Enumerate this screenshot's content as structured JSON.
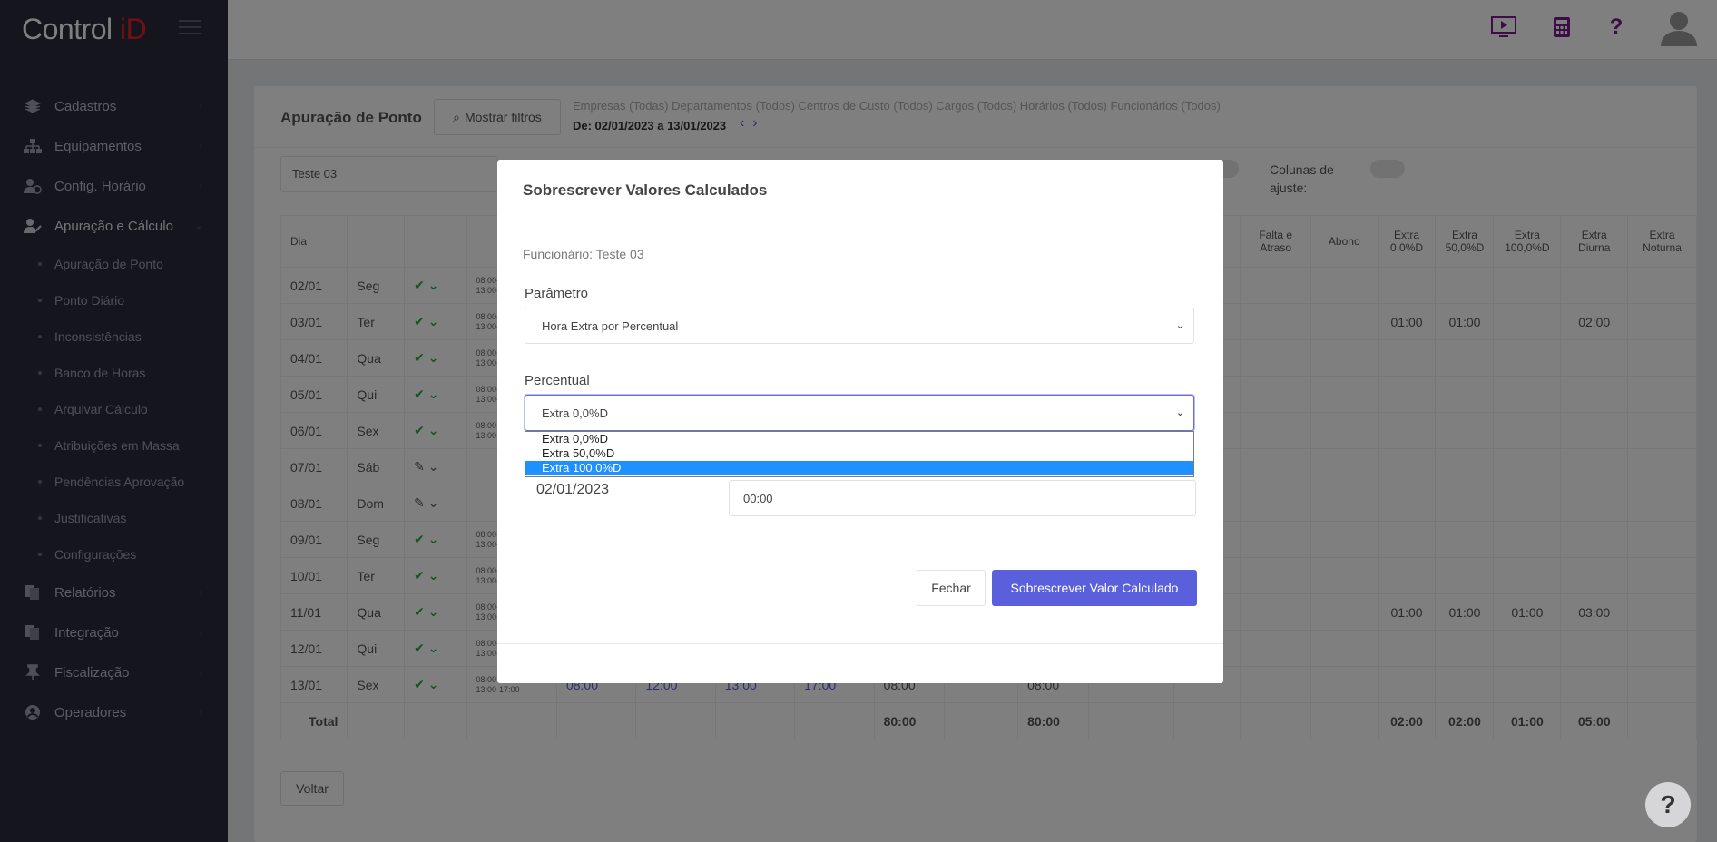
{
  "app": {
    "logo_main": "Control ",
    "logo_id": "iD"
  },
  "sidebar": {
    "items": [
      {
        "label": "Cadastros",
        "icon": "layers-icon"
      },
      {
        "label": "Equipamentos",
        "icon": "sitemap-icon"
      },
      {
        "label": "Config. Horário",
        "icon": "user-clock-icon"
      },
      {
        "label": "Apuração e Cálculo",
        "icon": "user-edit-icon"
      }
    ],
    "subitems": [
      "Apuração de Ponto",
      "Ponto Diário",
      "Inconsistências",
      "Banco de Horas",
      "Arquivar Cálculo",
      "Atribuições em Massa",
      "Pendências Aprovação",
      "Justificativas",
      "Configurações"
    ],
    "items_after": [
      {
        "label": "Relatórios",
        "icon": "files-icon"
      },
      {
        "label": "Integração",
        "icon": "files-icon"
      },
      {
        "label": "Fiscalização",
        "icon": "pin-icon"
      },
      {
        "label": "Operadores",
        "icon": "user-circle-icon"
      }
    ]
  },
  "header": {
    "icons": [
      "monitor-play-icon",
      "calculator-icon",
      "question-icon",
      "user-avatar-icon"
    ]
  },
  "page": {
    "title": "Apuração de Ponto",
    "filter_button": "Mostrar filtros",
    "filters": "Empresas (Todas)  Departamentos (Todos)  Centros de Custo (Todos)  Cargos (Todos)  Horários (Todos)  Funcionários (Todos)",
    "date_range": "De: 02/01/2023 a 13/01/2023",
    "employee": "Teste 03",
    "columns_adjust": "Colunas de ajuste:",
    "col_dia": "Dia",
    "extra_headers": [
      "Falta e Atraso",
      "Abono",
      "Extra 0,0%D",
      "Extra 50,0%D",
      "Extra 100,0%D",
      "Extra Diurna",
      "Extra Noturna"
    ],
    "rows": [
      {
        "d": "02/01",
        "w": "Seg",
        "ok": true,
        "sch": "08:00-12:...\n13:00-17:..."
      },
      {
        "d": "03/01",
        "w": "Ter",
        "ok": true,
        "sch": "08:00-12:...\n13:00-17:..."
      },
      {
        "d": "04/01",
        "w": "Qua",
        "ok": true,
        "sch": "08:00-12:...\n13:00-17:..."
      },
      {
        "d": "05/01",
        "w": "Qui",
        "ok": true,
        "sch": "08:00-12:...\n13:00-17:..."
      },
      {
        "d": "06/01",
        "w": "Sex",
        "ok": true,
        "sch": "08:00-12:...\n13:00-17:..."
      },
      {
        "d": "07/01",
        "w": "Sáb",
        "ok": false,
        "sch": ""
      },
      {
        "d": "08/01",
        "w": "Dom",
        "ok": false,
        "sch": ""
      },
      {
        "d": "09/01",
        "w": "Seg",
        "ok": true,
        "sch": "08:00-12:...\n13:00-17:..."
      },
      {
        "d": "10/01",
        "w": "Ter",
        "ok": true,
        "sch": "08:00-12:...\n13:00-17:..."
      },
      {
        "d": "11/01",
        "w": "Qua",
        "ok": true,
        "sch": "08:00-12:...\n13:00-17:..."
      },
      {
        "d": "12/01",
        "w": "Qui",
        "ok": true,
        "sch": "08:00-12:...\n13:00-17:..."
      },
      {
        "d": "13/01",
        "w": "Sex",
        "ok": true,
        "sch": "08:00-12:00\n13:00-17:00"
      }
    ],
    "row13_punches": [
      "08:00",
      "12:00",
      "13:00",
      "17:00",
      "08:00",
      "08:00"
    ],
    "row03_extras": {
      "e0": "01:00",
      "e50": "01:00",
      "diurna": "02:00"
    },
    "row11_extras": {
      "e0": "01:00",
      "e50": "01:00",
      "e100": "01:00",
      "diurna": "03:00"
    },
    "total_label": "Total",
    "totals": {
      "t1": "80:00",
      "t2": "80:00",
      "e0": "02:00",
      "e50": "02:00",
      "e100": "01:00",
      "diurna": "05:00"
    },
    "back_button": "Voltar"
  },
  "modal": {
    "title": "Sobrescrever Valores Calculados",
    "employee_line": "Funcionário: Teste 03",
    "param_label": "Parâmetro",
    "param_value": "Hora Extra por Percentual",
    "perc_label": "Percentual",
    "perc_value": "Extra 0,0%D",
    "options": [
      "Extra 0,0%D",
      "Extra 50,0%D",
      "Extra 100,0%D"
    ],
    "selected_option": 2,
    "date": "02/01/2023",
    "time_value": "00:00",
    "close_button": "Fechar",
    "save_button": "Sobrescrever Valor Calculado"
  },
  "help": {
    "label": "?"
  }
}
